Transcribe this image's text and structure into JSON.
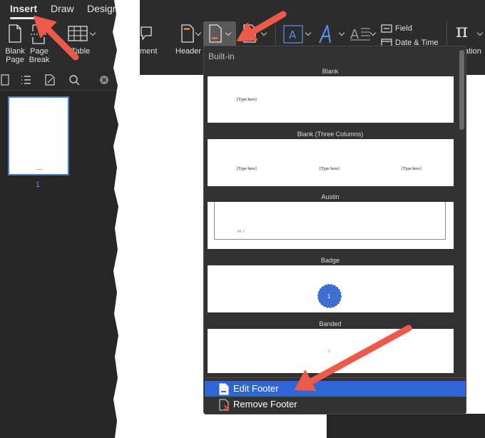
{
  "ribbon_tabs": [
    "Insert",
    "Draw",
    "Design"
  ],
  "left_ribbon": {
    "blank_page": "Blank\nPage",
    "page_break": "Page\nBreak",
    "table": "Table",
    "comment_partial": "ment"
  },
  "right_ribbon": {
    "header": "Header",
    "field": "Field",
    "date_time": "Date & Time",
    "equation_partial": "ation"
  },
  "thumbnail_page_number": "1",
  "gallery": {
    "section_title": "Built-in",
    "categories": [
      {
        "name": "Blank",
        "placeholders": [
          "[Type here]"
        ]
      },
      {
        "name": "Blank (Three Columns)",
        "placeholders": [
          "[Type here]",
          "[Type here]",
          "[Type here]"
        ]
      },
      {
        "name": "Austin",
        "placeholders": [
          "pg. 1"
        ]
      },
      {
        "name": "Badge",
        "placeholders": [
          "1"
        ]
      },
      {
        "name": "Banded",
        "placeholders": [
          "1"
        ]
      }
    ]
  },
  "menu": {
    "edit_footer": "Edit Footer",
    "remove_footer": "Remove Footer"
  },
  "colors": {
    "annotation_arrow": "#ee5a4a",
    "selection_blue": "#2f65d6",
    "badge_blue": "#3f6fd0",
    "ribbon_dark": "#2c2c2c"
  }
}
